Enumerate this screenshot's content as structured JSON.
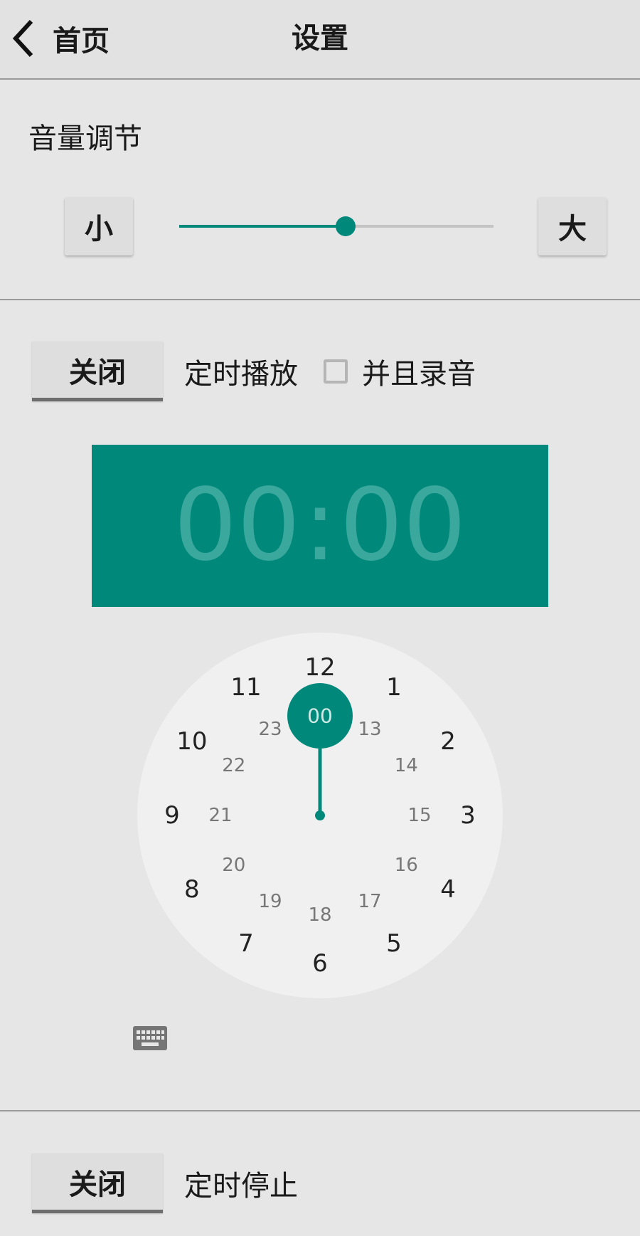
{
  "header": {
    "back_label": "首页",
    "title": "设置"
  },
  "volume": {
    "title": "音量调节",
    "min_label": "小",
    "max_label": "大",
    "level": 0.53
  },
  "timed_play": {
    "toggle_label": "关闭",
    "label": "定时播放",
    "record_label": "并且录音",
    "record_checked": false
  },
  "time_picker": {
    "hour": "00",
    "separator": ":",
    "minute": "00",
    "outer_numbers": [
      "12",
      "1",
      "2",
      "3",
      "4",
      "5",
      "6",
      "7",
      "8",
      "9",
      "10",
      "11"
    ],
    "inner_numbers": [
      "00",
      "13",
      "14",
      "15",
      "16",
      "17",
      "18",
      "19",
      "20",
      "21",
      "22",
      "23"
    ],
    "selected": "00",
    "accent_color": "#00897b"
  },
  "timed_stop": {
    "toggle_label": "关闭",
    "label": "定时停止"
  }
}
